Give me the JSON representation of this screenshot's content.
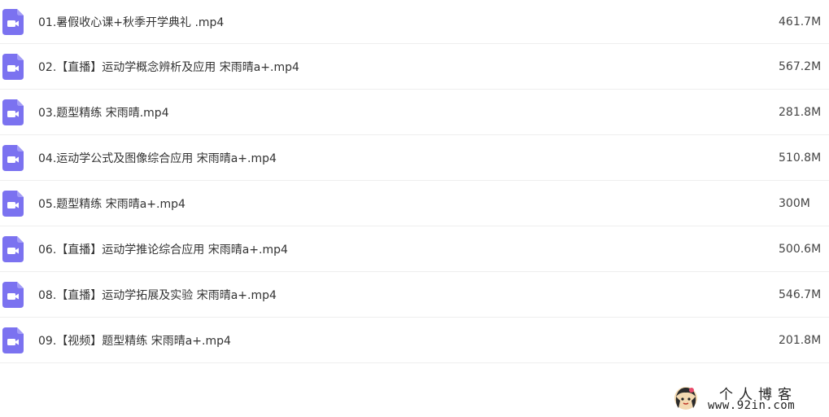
{
  "colors": {
    "video_icon": "#7b72f0",
    "row_divider": "#eeeeee"
  },
  "files": [
    {
      "name": "01.暑假收心课+秋季开学典礼 .mp4",
      "size": "461.7M",
      "icon": "video-file-icon"
    },
    {
      "name": "02.【直播】运动学概念辨析及应用 宋雨晴a+.mp4",
      "size": "567.2M",
      "icon": "video-file-icon"
    },
    {
      "name": "03.题型精练 宋雨晴.mp4",
      "size": "281.8M",
      "icon": "video-file-icon"
    },
    {
      "name": "04.运动学公式及图像综合应用 宋雨晴a+.mp4",
      "size": "510.8M",
      "icon": "video-file-icon"
    },
    {
      "name": "05.题型精练 宋雨晴a+.mp4",
      "size": "300M",
      "icon": "video-file-icon"
    },
    {
      "name": "06.【直播】运动学推论综合应用 宋雨晴a+.mp4",
      "size": "500.6M",
      "icon": "video-file-icon"
    },
    {
      "name": "08.【直播】运动学拓展及实验 宋雨晴a+.mp4",
      "size": "546.7M",
      "icon": "video-file-icon"
    },
    {
      "name": "09.【视频】题型精练 宋雨晴a+.mp4",
      "size": "201.8M",
      "icon": "video-file-icon"
    }
  ],
  "watermark": {
    "title": "个人博客",
    "url": "www.92in.com",
    "icon": "avatar-icon"
  }
}
